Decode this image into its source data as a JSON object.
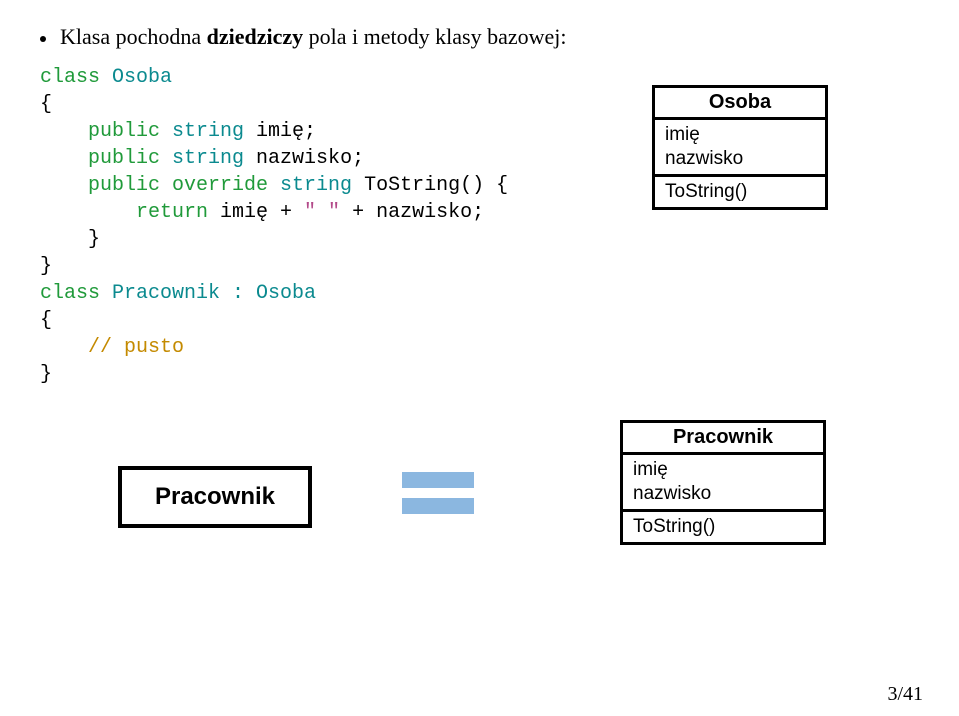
{
  "bullet": {
    "text_before": "Klasa pochodna ",
    "bold_word": "dziedziczy",
    "text_after": " pola i metody klasy bazowej:"
  },
  "code": {
    "line1a": "class",
    "line1b": " Osoba",
    "line2": "{",
    "line3a": "    public ",
    "line3b": "string",
    "line3c": " imię;",
    "line4a": "    public ",
    "line4b": "string",
    "line4c": " nazwisko;",
    "line5a": "    public override ",
    "line5b": "string",
    "line5c": " ToString() {",
    "line6a": "        return",
    "line6b": " imię + ",
    "line6c": "\" \"",
    "line6d": " + nazwisko;",
    "line7": "    }",
    "line8": "}",
    "line9a": "class",
    "line9b": " Pracownik : ",
    "line9c": "Osoba",
    "line10": "{",
    "line11a": "    // pusto",
    "line12": "}"
  },
  "uml_osoba": {
    "title": "Osoba",
    "attr1": "imię",
    "attr2": "nazwisko",
    "op1": "ToString()"
  },
  "simple_box": {
    "title": "Pracownik"
  },
  "uml_pracownik": {
    "title": "Pracownik",
    "attr1": "imię",
    "attr2": "nazwisko",
    "op1": "ToString()"
  },
  "page": "3/41"
}
